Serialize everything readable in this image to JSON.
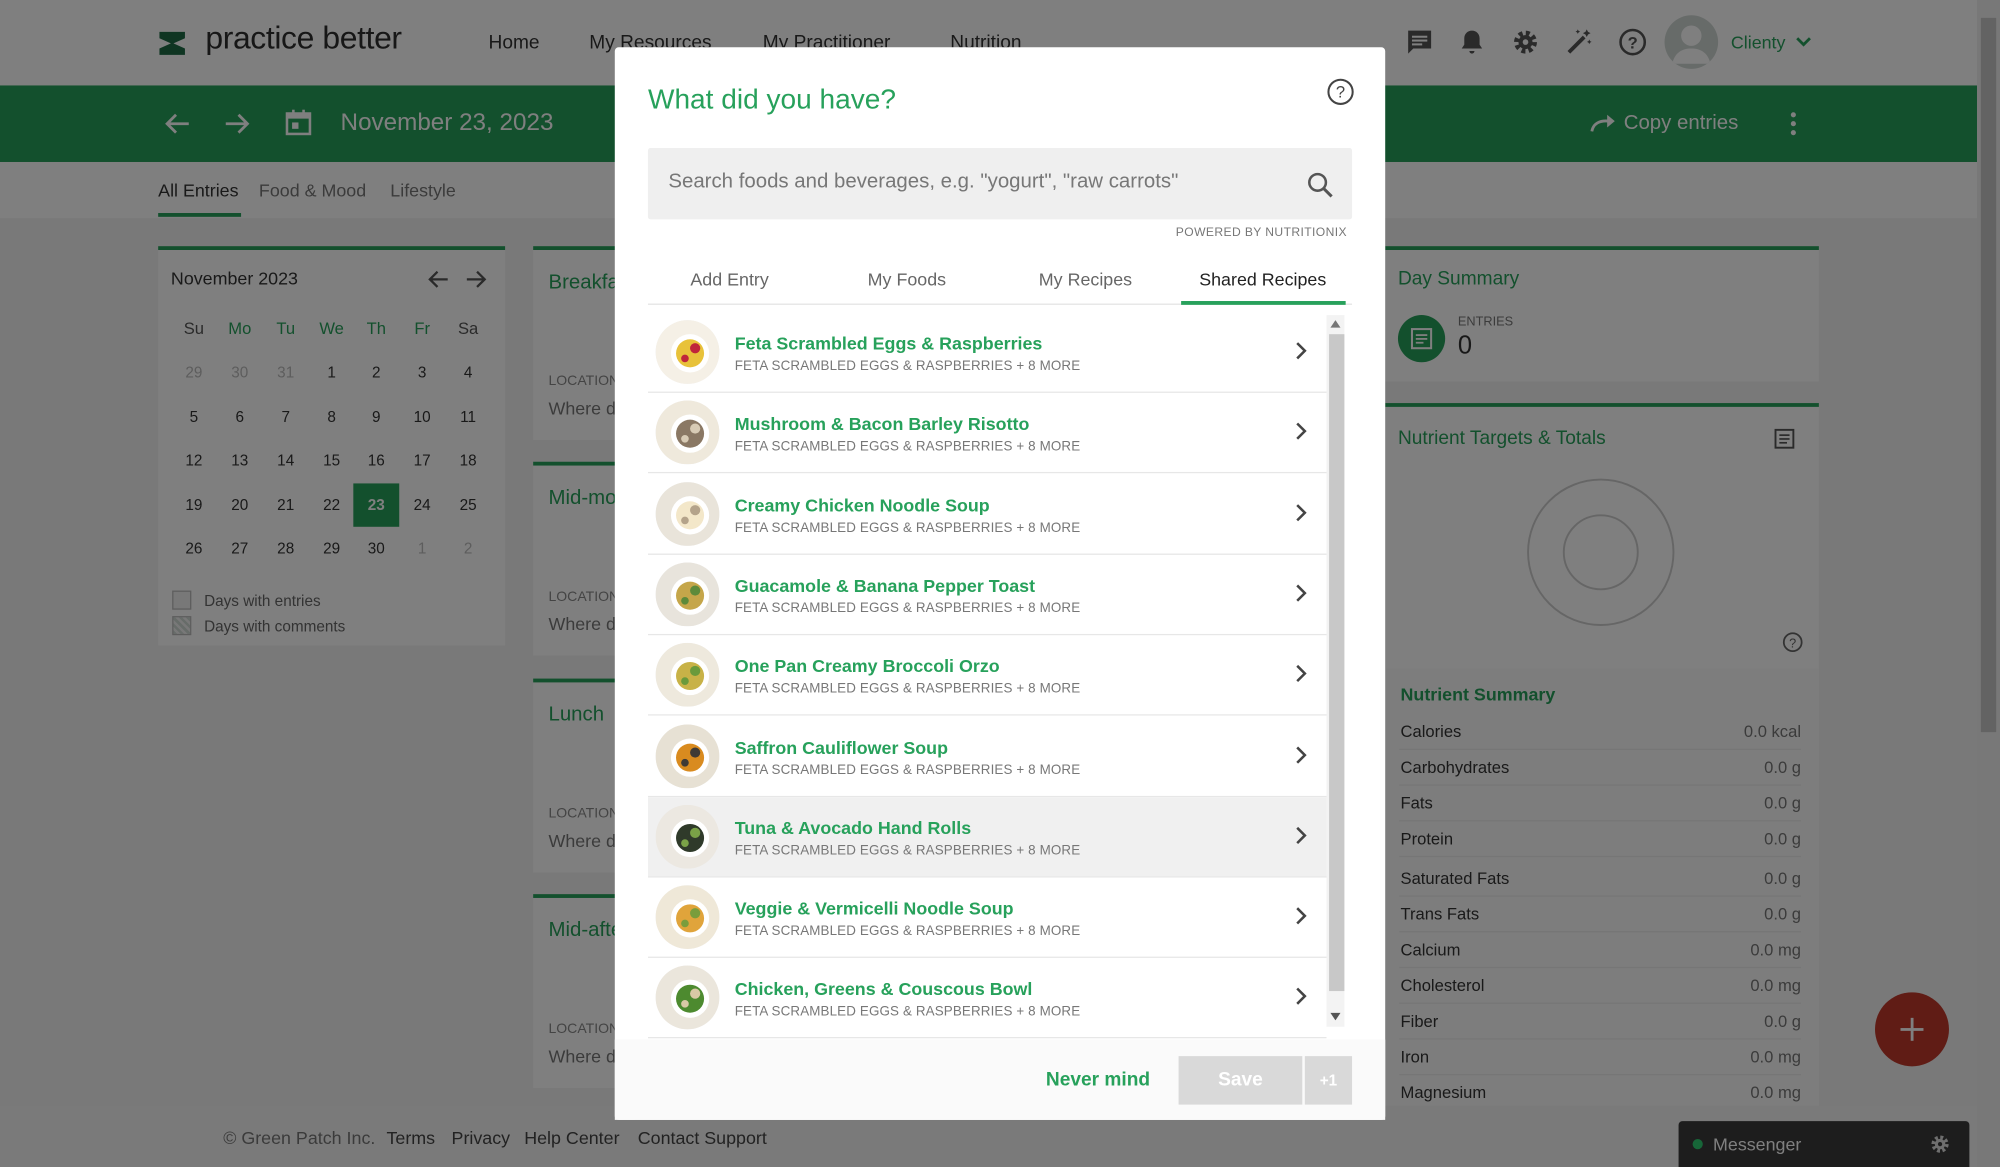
{
  "app": {
    "brand": "practice better",
    "nav": [
      "Home",
      "My Resources",
      "My Practitioner",
      "Nutrition"
    ],
    "user_name": "Clienty",
    "colors": {
      "accent": "#27a15b",
      "fab": "#c0392b"
    }
  },
  "toolbar": {
    "date": "November 23, 2023",
    "copy_entries": "Copy entries"
  },
  "subtabs": [
    "All Entries",
    "Food & Mood",
    "Lifestyle"
  ],
  "calendar": {
    "month_label": "November 2023",
    "day_headers": [
      "Su",
      "Mo",
      "Tu",
      "We",
      "Th",
      "Fr",
      "Sa"
    ],
    "weeks": [
      [
        "29",
        "30",
        "31",
        "1",
        "2",
        "3",
        "4"
      ],
      [
        "5",
        "6",
        "7",
        "8",
        "9",
        "10",
        "11"
      ],
      [
        "12",
        "13",
        "14",
        "15",
        "16",
        "17",
        "18"
      ],
      [
        "19",
        "20",
        "21",
        "22",
        "23",
        "24",
        "25"
      ],
      [
        "26",
        "27",
        "28",
        "29",
        "30",
        "1",
        "2"
      ]
    ],
    "selected": "23",
    "legend": [
      "Days with entries",
      "Days with comments"
    ]
  },
  "meals": [
    {
      "title": "Breakfast",
      "location_label": "LOCATION",
      "location_value": "Where did you eat?"
    },
    {
      "title": "Mid-morning",
      "location_label": "LOCATION",
      "location_value": "Where did you eat?"
    },
    {
      "title": "Lunch",
      "location_label": "LOCATION",
      "location_value": "Where did you eat?"
    },
    {
      "title": "Mid-afternoon",
      "location_label": "LOCATION",
      "location_value": "Where did you eat?"
    }
  ],
  "day_summary": {
    "title": "Day Summary",
    "entries_label": "ENTRIES",
    "entries_value": "0"
  },
  "nutrient_targets": {
    "title": "Nutrient Targets & Totals",
    "summary_title": "Nutrient Summary",
    "rows": [
      {
        "name": "Calories",
        "value": "0.0 kcal"
      },
      {
        "name": "Carbohydrates",
        "value": "0.0 g"
      },
      {
        "name": "Fats",
        "value": "0.0 g"
      },
      {
        "name": "Protein",
        "value": "0.0 g"
      },
      {
        "name": "Saturated Fats",
        "value": "0.0 g"
      },
      {
        "name": "Trans Fats",
        "value": "0.0 g"
      },
      {
        "name": "Calcium",
        "value": "0.0 mg"
      },
      {
        "name": "Cholesterol",
        "value": "0.0 mg"
      },
      {
        "name": "Fiber",
        "value": "0.0 g"
      },
      {
        "name": "Iron",
        "value": "0.0 mg"
      },
      {
        "name": "Magnesium",
        "value": "0.0 mg"
      }
    ]
  },
  "modal": {
    "title": "What did you have?",
    "search_placeholder": "Search foods and beverages, e.g. \"yogurt\", \"raw carrots\"",
    "powered_by": "POWERED BY NUTRITIONIX",
    "tabs": [
      "Add Entry",
      "My Foods",
      "My Recipes",
      "Shared Recipes"
    ],
    "active_tab": "Shared Recipes",
    "recipes": [
      {
        "title": "Feta Scrambled Eggs & Raspberries",
        "subtitle": "FETA SCRAMBLED EGGS & RASPBERRIES + 8 MORE"
      },
      {
        "title": "Mushroom & Bacon Barley Risotto",
        "subtitle": "FETA SCRAMBLED EGGS & RASPBERRIES + 8 MORE"
      },
      {
        "title": "Creamy Chicken Noodle Soup",
        "subtitle": "FETA SCRAMBLED EGGS & RASPBERRIES + 8 MORE"
      },
      {
        "title": "Guacamole & Banana Pepper Toast",
        "subtitle": "FETA SCRAMBLED EGGS & RASPBERRIES + 8 MORE"
      },
      {
        "title": "One Pan Creamy Broccoli Orzo",
        "subtitle": "FETA SCRAMBLED EGGS & RASPBERRIES + 8 MORE"
      },
      {
        "title": "Saffron Cauliflower Soup",
        "subtitle": "FETA SCRAMBLED EGGS & RASPBERRIES + 8 MORE"
      },
      {
        "title": "Tuna & Avocado Hand Rolls",
        "subtitle": "FETA SCRAMBLED EGGS & RASPBERRIES + 8 MORE"
      },
      {
        "title": "Veggie & Vermicelli Noodle Soup",
        "subtitle": "FETA SCRAMBLED EGGS & RASPBERRIES + 8 MORE"
      },
      {
        "title": "Chicken, Greens & Couscous Bowl",
        "subtitle": "FETA SCRAMBLED EGGS & RASPBERRIES + 8 MORE"
      }
    ],
    "never_mind": "Never mind",
    "save": "Save",
    "save_count": "+1"
  },
  "footer": {
    "copyright": "© Green Patch Inc.",
    "links": [
      "Terms",
      "Privacy",
      "Help Center",
      "Contact Support"
    ]
  },
  "messenger": {
    "label": "Messenger"
  }
}
